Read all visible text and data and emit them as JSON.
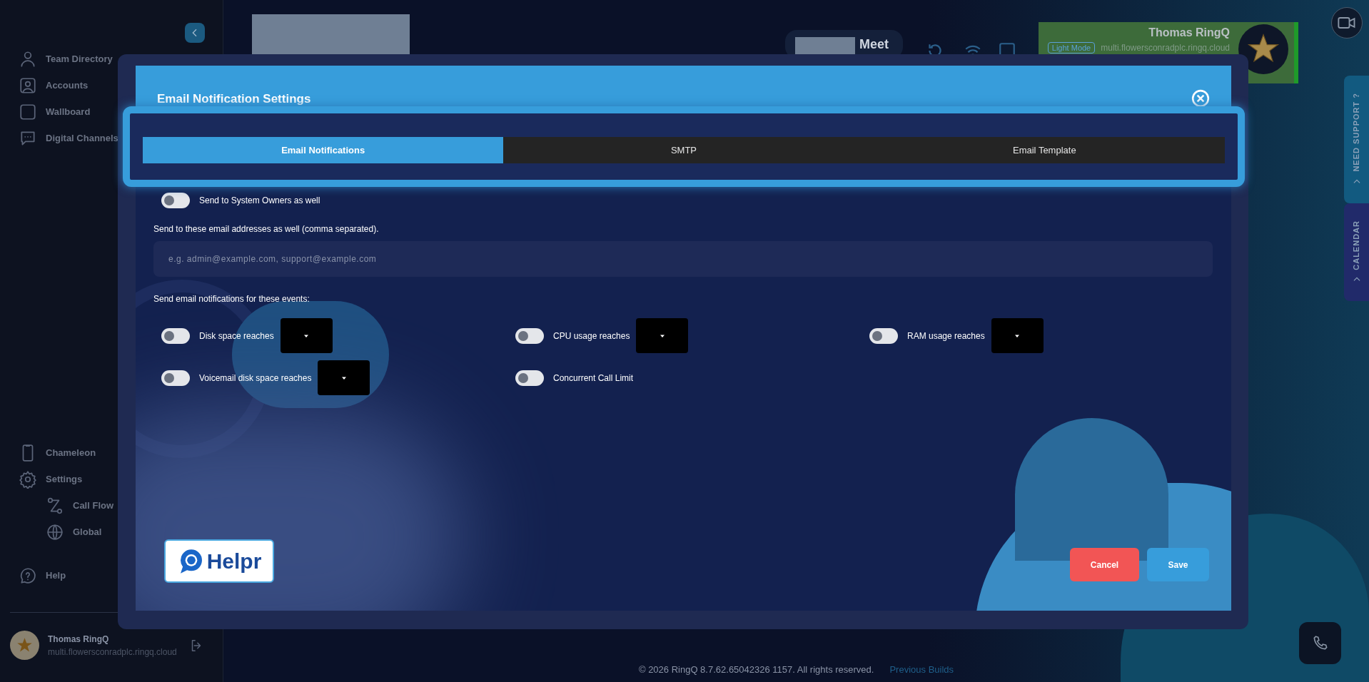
{
  "sidebar": {
    "items": [
      {
        "label": "Team Directory"
      },
      {
        "label": "Accounts"
      },
      {
        "label": "Wallboard"
      },
      {
        "label": "Digital Channels"
      },
      {
        "label": "Chameleon"
      },
      {
        "label": "Settings",
        "children": [
          {
            "label": "Call Flow"
          },
          {
            "label": "Global"
          }
        ]
      },
      {
        "label": "Help"
      }
    ],
    "user": {
      "name": "Thomas RingQ",
      "domain": "multi.flowersconradplc.ringq.cloud"
    }
  },
  "top_bar": {
    "meet_label": "Meet",
    "profile": {
      "name": "Thomas RingQ",
      "mode_badge": "Light Mode",
      "domain": "multi.flowersconradplc.ringq.cloud"
    }
  },
  "side_tabs": [
    "NEED SUPPORT ?",
    "CALENDAR"
  ],
  "modal": {
    "title": "Email Notification Settings",
    "tabs": [
      {
        "label": "Email Notifications",
        "selected": true
      },
      {
        "label": "SMTP",
        "selected": false
      },
      {
        "label": "Email Template",
        "selected": false
      }
    ],
    "owners_toggle": {
      "label": "Send to System Owners as well",
      "on": false
    },
    "emails_label": "Send to these email addresses as well (comma separated).",
    "emails_field": {
      "placeholder": "e.g. admin@example.com, support@example.com"
    },
    "events_label": "Send email notifications for these events:",
    "events": [
      {
        "label": "Disk space reaches",
        "kind": "threshold",
        "on": false
      },
      {
        "label": "CPU usage reaches",
        "kind": "threshold",
        "on": false
      },
      {
        "label": "RAM usage reaches",
        "kind": "threshold",
        "on": false
      },
      {
        "label": "Voicemail disk space reaches",
        "kind": "threshold",
        "on": false
      },
      {
        "label": "Concurrent Call Limit",
        "kind": "toggle",
        "on": false
      }
    ],
    "logo_text": "Helpr",
    "buttons": [
      {
        "label": "Cancel",
        "kind": "cancel"
      },
      {
        "label": "Save",
        "kind": "save"
      }
    ]
  },
  "footer": {
    "copyright": "© 2026 RingQ 8.7.62.65042326 1157. All rights reserved.",
    "link": "Previous Builds"
  }
}
